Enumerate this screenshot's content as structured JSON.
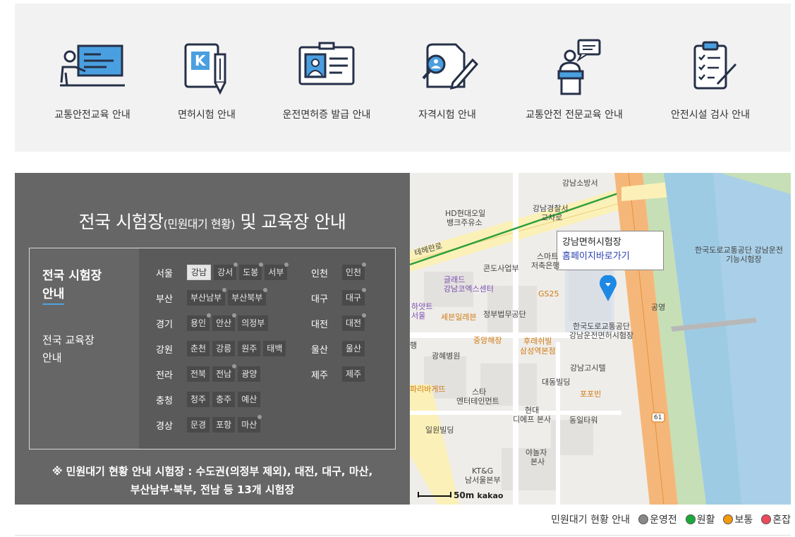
{
  "services": [
    {
      "label": "교통안전교육 안내",
      "icon": "lecture-icon"
    },
    {
      "label": "면허시험 안내",
      "icon": "exam-pen-icon"
    },
    {
      "label": "운전면허증 발급 안내",
      "icon": "license-card-icon"
    },
    {
      "label": "자격시험 안내",
      "icon": "qualification-icon"
    },
    {
      "label": "교통안전 전문교육 안내",
      "icon": "speaker-podium-icon"
    },
    {
      "label": "안전시설 검사 안내",
      "icon": "checklist-icon"
    }
  ],
  "panel": {
    "title_main": "전국 시험장",
    "title_small": "(민원대기 현황)",
    "title_rest": " 및 교육장 안내",
    "nav_exam": "전국 시험장 안내",
    "nav_exam_line1": "전국 시험장",
    "nav_exam_line2": "안내",
    "nav_edu_line1": "전국 교육장",
    "nav_edu_line2": "안내",
    "regions_left": [
      {
        "region": "서울",
        "items": [
          {
            "name": "강남",
            "active": true
          },
          {
            "name": "강서",
            "dot": true
          },
          {
            "name": "도봉",
            "dot": true
          },
          {
            "name": "서부",
            "dot": true
          }
        ]
      },
      {
        "region": "부산",
        "items": [
          {
            "name": "부산남부",
            "dot": true
          },
          {
            "name": "부산북부",
            "dot": true
          }
        ]
      },
      {
        "region": "경기",
        "items": [
          {
            "name": "용인",
            "dot": true
          },
          {
            "name": "안산",
            "dot": true
          },
          {
            "name": "의정부"
          }
        ]
      },
      {
        "region": "강원",
        "items": [
          {
            "name": "춘천"
          },
          {
            "name": "강릉"
          },
          {
            "name": "원주"
          },
          {
            "name": "태백"
          }
        ]
      },
      {
        "region": "전라",
        "items": [
          {
            "name": "전북"
          },
          {
            "name": "전남",
            "dot": true
          },
          {
            "name": "광양"
          }
        ]
      },
      {
        "region": "충청",
        "items": [
          {
            "name": "청주"
          },
          {
            "name": "충주"
          },
          {
            "name": "예산"
          }
        ]
      },
      {
        "region": "경상",
        "items": [
          {
            "name": "문경"
          },
          {
            "name": "포항"
          },
          {
            "name": "마산",
            "dot": true
          }
        ]
      }
    ],
    "regions_right": [
      {
        "region": "인천",
        "items": [
          {
            "name": "인천",
            "dot": true
          }
        ]
      },
      {
        "region": "대구",
        "items": [
          {
            "name": "대구",
            "dot": true
          }
        ]
      },
      {
        "region": "대전",
        "items": [
          {
            "name": "대전",
            "dot": true
          }
        ]
      },
      {
        "region": "울산",
        "items": [
          {
            "name": "울산"
          }
        ]
      },
      {
        "region": "제주",
        "items": [
          {
            "name": "제주"
          }
        ]
      }
    ],
    "note_line1": "※ 민원대기 현황 안내 시험장 : 수도권(의정부 제외), 대전, 대구, 마산,",
    "note_line2": "부산남부·북부, 전남 등 13개 시험장"
  },
  "map": {
    "popup_title": "강남면허시험장",
    "popup_link": "홈페이지바로가기",
    "scale_label": "50m",
    "brand": "kakao",
    "labels": [
      "강남소방서",
      "강남경찰서",
      "교차로",
      "HD현대오일",
      "뱅크주유소",
      "테헤란로",
      "스마트",
      "저축은행",
      "콘도사업부",
      "글래드",
      "강남코엑스센터",
      "GS25",
      "하얏트",
      "서울",
      "세븐일레븐",
      "정부법무공단",
      "중앙해장",
      "후레쉬빌",
      "삼성역본점",
      "한국도로교통공단",
      "강남운전면허시험장",
      "광혜병원",
      "행",
      "강남고시텔",
      "대동빌딩",
      "포포빈",
      "파리바게뜨",
      "스타",
      "엔터테인먼트",
      "현대",
      "디에프 본사",
      "동일타워",
      "일원빌딩",
      "야놀자",
      "본사",
      "KT&G",
      "남서울본부",
      "한국도로교통공단 강남운전",
      "기능시험장",
      "공영",
      "61"
    ]
  },
  "legend": {
    "title": "민원대기 현황 안내",
    "items": [
      {
        "label": "운영전",
        "color": "#888888"
      },
      {
        "label": "원활",
        "color": "#1aaa3a"
      },
      {
        "label": "보통",
        "color": "#f39a0e"
      },
      {
        "label": "혼잡",
        "color": "#ec4a5a"
      }
    ]
  }
}
